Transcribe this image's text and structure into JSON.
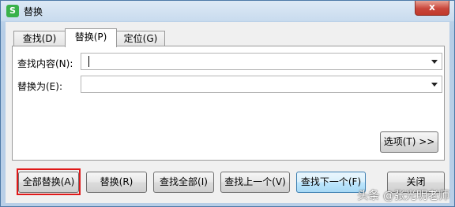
{
  "window": {
    "title": "替换",
    "app_icon": "S",
    "close_label": "x",
    "accent": "#4e7aa8",
    "close_color": "#c9463b"
  },
  "tabs": [
    {
      "label": "查找(D)",
      "active": false
    },
    {
      "label": "替换(P)",
      "active": true
    },
    {
      "label": "定位(G)",
      "active": false
    }
  ],
  "find": {
    "label": "查找内容(N):",
    "value": ""
  },
  "replace": {
    "label": "替换为(E):",
    "value": ""
  },
  "options_button": "选项(T) >>",
  "buttons": {
    "replace_all": "全部替换(A)",
    "replace": "替换(R)",
    "find_all": "查找全部(I)",
    "find_prev": "查找上一个(V)",
    "find_next": "查找下一个(F)",
    "close": "关闭"
  },
  "highlight_color": "#e01818",
  "watermark": "头条 @张光明老师"
}
